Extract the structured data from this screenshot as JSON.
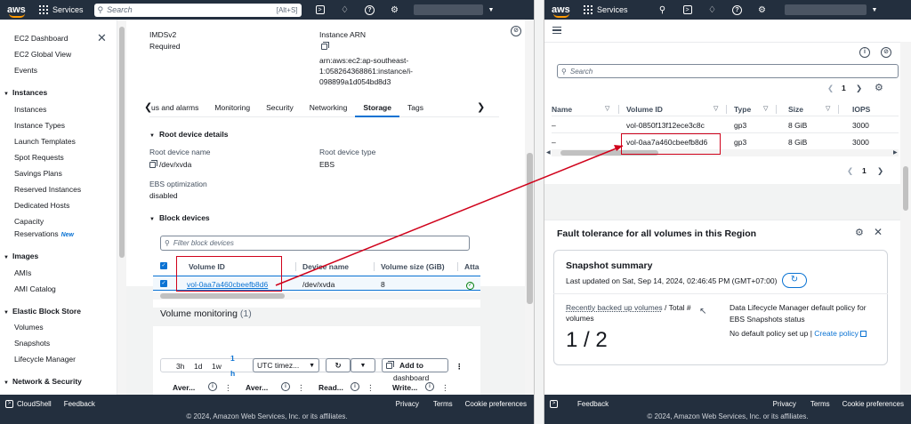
{
  "nav": {
    "logo": "aws",
    "services": "Services",
    "search_placeholder": "Search",
    "search_shortcut": "[Alt+S]"
  },
  "sidebar": {
    "top_items": [
      "EC2 Dashboard",
      "EC2 Global View",
      "Events"
    ],
    "sections": [
      {
        "title": "Instances",
        "items": [
          "Instances",
          "Instance Types",
          "Launch Templates",
          "Spot Requests",
          "Savings Plans",
          "Reserved Instances",
          "Dedicated Hosts",
          "Capacity",
          "Reservations"
        ]
      },
      {
        "title": "Images",
        "items": [
          "AMIs",
          "AMI Catalog"
        ]
      },
      {
        "title": "Elastic Block Store",
        "items": [
          "Volumes",
          "Snapshots",
          "Lifecycle Manager"
        ]
      },
      {
        "title": "Network & Security",
        "items": []
      }
    ],
    "new_badge": "New"
  },
  "details": {
    "imds_label": "IMDSv2",
    "imds_value": "Required",
    "arn_label": "Instance ARN",
    "arn_line1": "arn:aws:ec2:ap-southeast-",
    "arn_line2": "1:058264368861:instance/i-",
    "arn_line3": "098899a1d054bd8d3"
  },
  "tabs": [
    "us and alarms",
    "Monitoring",
    "Security",
    "Networking",
    "Storage",
    "Tags"
  ],
  "tabs_active": "Storage",
  "root_device": {
    "section_title": "Root device details",
    "name_label": "Root device name",
    "name_value": "/dev/xvda",
    "type_label": "Root device type",
    "type_value": "EBS",
    "ebs_label": "EBS optimization",
    "ebs_value": "disabled"
  },
  "block_devices": {
    "section_title": "Block devices",
    "filter_placeholder": "Filter block devices",
    "columns": [
      "Volume ID",
      "Device name",
      "Volume size (GiB)",
      "Atta"
    ],
    "row": {
      "volume_id": "vol-0aa7a460cbeefb8d6",
      "device": "/dev/xvda",
      "size": "8"
    }
  },
  "monitoring": {
    "title": "Volume monitoring",
    "count": "(1)",
    "ranges": [
      "3h",
      "1d",
      "1w"
    ],
    "custom_top": "1",
    "custom_bottom": "h",
    "timezone": "UTC timez...",
    "add_dashboard": "Add to",
    "add_dashboard2": "dashboard",
    "metrics": [
      "Aver...",
      "Aver...",
      "Read...",
      "Write..."
    ]
  },
  "footer": {
    "cloudshell": "CloudShell",
    "feedback": "Feedback",
    "privacy": "Privacy",
    "terms": "Terms",
    "cookies": "Cookie preferences",
    "copyright": "© 2024, Amazon Web Services, Inc. or its affiliates."
  },
  "right": {
    "search_placeholder": "Search",
    "page": "1",
    "columns": [
      "Name",
      "Volume ID",
      "Type",
      "Size",
      "IOPS"
    ],
    "rows": [
      {
        "name": "–",
        "volume_id": "vol-0850f13f12ece3c8c",
        "type": "gp3",
        "size": "8 GiB",
        "iops": "3000"
      },
      {
        "name": "–",
        "volume_id": "vol-0aa7a460cbeefb8d6",
        "type": "gp3",
        "size": "8 GiB",
        "iops": "3000"
      }
    ],
    "page_bottom": "1",
    "fault_title": "Fault tolerance for all volumes in this Region",
    "card_title": "Snapshot summary",
    "last_updated": "Last updated on Sat, Sep 14, 2024, 02:46:45 PM (GMT+07:00)",
    "backed_up_link": "Recently backed up volumes",
    "backed_up_rest": " / Total #",
    "backed_up_line2": "volumes",
    "backed_up_value": "1 / 2",
    "dlm_line1": "Data Lifecycle Manager default policy for",
    "dlm_line2": "EBS Snapshots status",
    "dlm_status": "No default policy set up | ",
    "create_policy": "Create policy"
  },
  "colors": {
    "nav_bg": "#232f3e",
    "link": "#0972d3",
    "highlight_red": "#d0021b",
    "aws_orange": "#ff9900"
  }
}
